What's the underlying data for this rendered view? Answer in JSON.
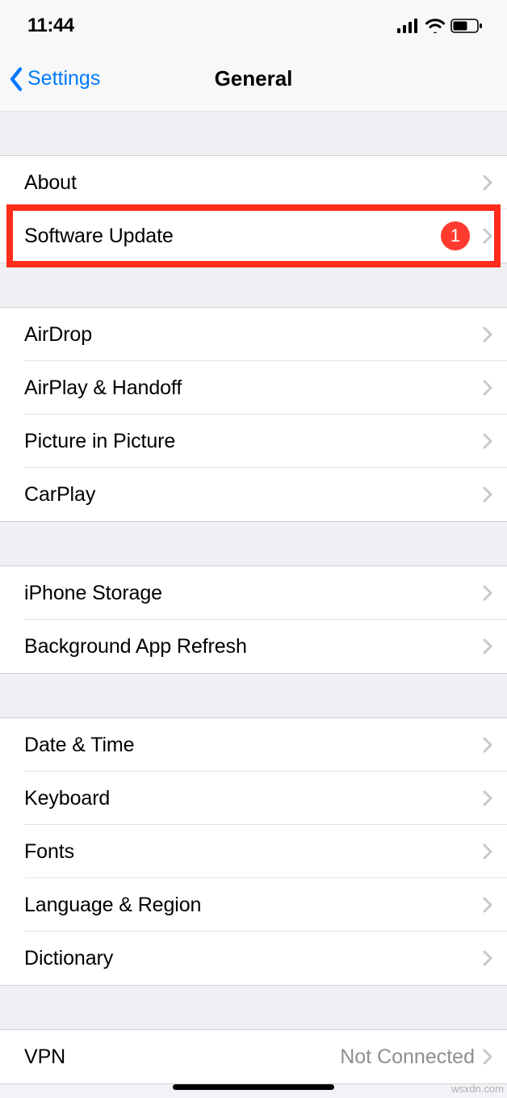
{
  "status": {
    "time": "11:44"
  },
  "nav": {
    "back_label": "Settings",
    "title": "General"
  },
  "groups": [
    {
      "rows": [
        {
          "slug": "about",
          "label": "About"
        },
        {
          "slug": "software-update",
          "label": "Software Update",
          "badge": "1",
          "highlighted": true
        }
      ]
    },
    {
      "rows": [
        {
          "slug": "airdrop",
          "label": "AirDrop"
        },
        {
          "slug": "airplay-handoff",
          "label": "AirPlay & Handoff"
        },
        {
          "slug": "picture-in-picture",
          "label": "Picture in Picture"
        },
        {
          "slug": "carplay",
          "label": "CarPlay"
        }
      ]
    },
    {
      "rows": [
        {
          "slug": "iphone-storage",
          "label": "iPhone Storage"
        },
        {
          "slug": "background-app-refresh",
          "label": "Background App Refresh"
        }
      ]
    },
    {
      "rows": [
        {
          "slug": "date-time",
          "label": "Date & Time"
        },
        {
          "slug": "keyboard",
          "label": "Keyboard"
        },
        {
          "slug": "fonts",
          "label": "Fonts"
        },
        {
          "slug": "language-region",
          "label": "Language & Region"
        },
        {
          "slug": "dictionary",
          "label": "Dictionary"
        }
      ]
    },
    {
      "rows": [
        {
          "slug": "vpn",
          "label": "VPN",
          "value": "Not Connected"
        }
      ]
    }
  ],
  "watermark": "wsxdn.com"
}
